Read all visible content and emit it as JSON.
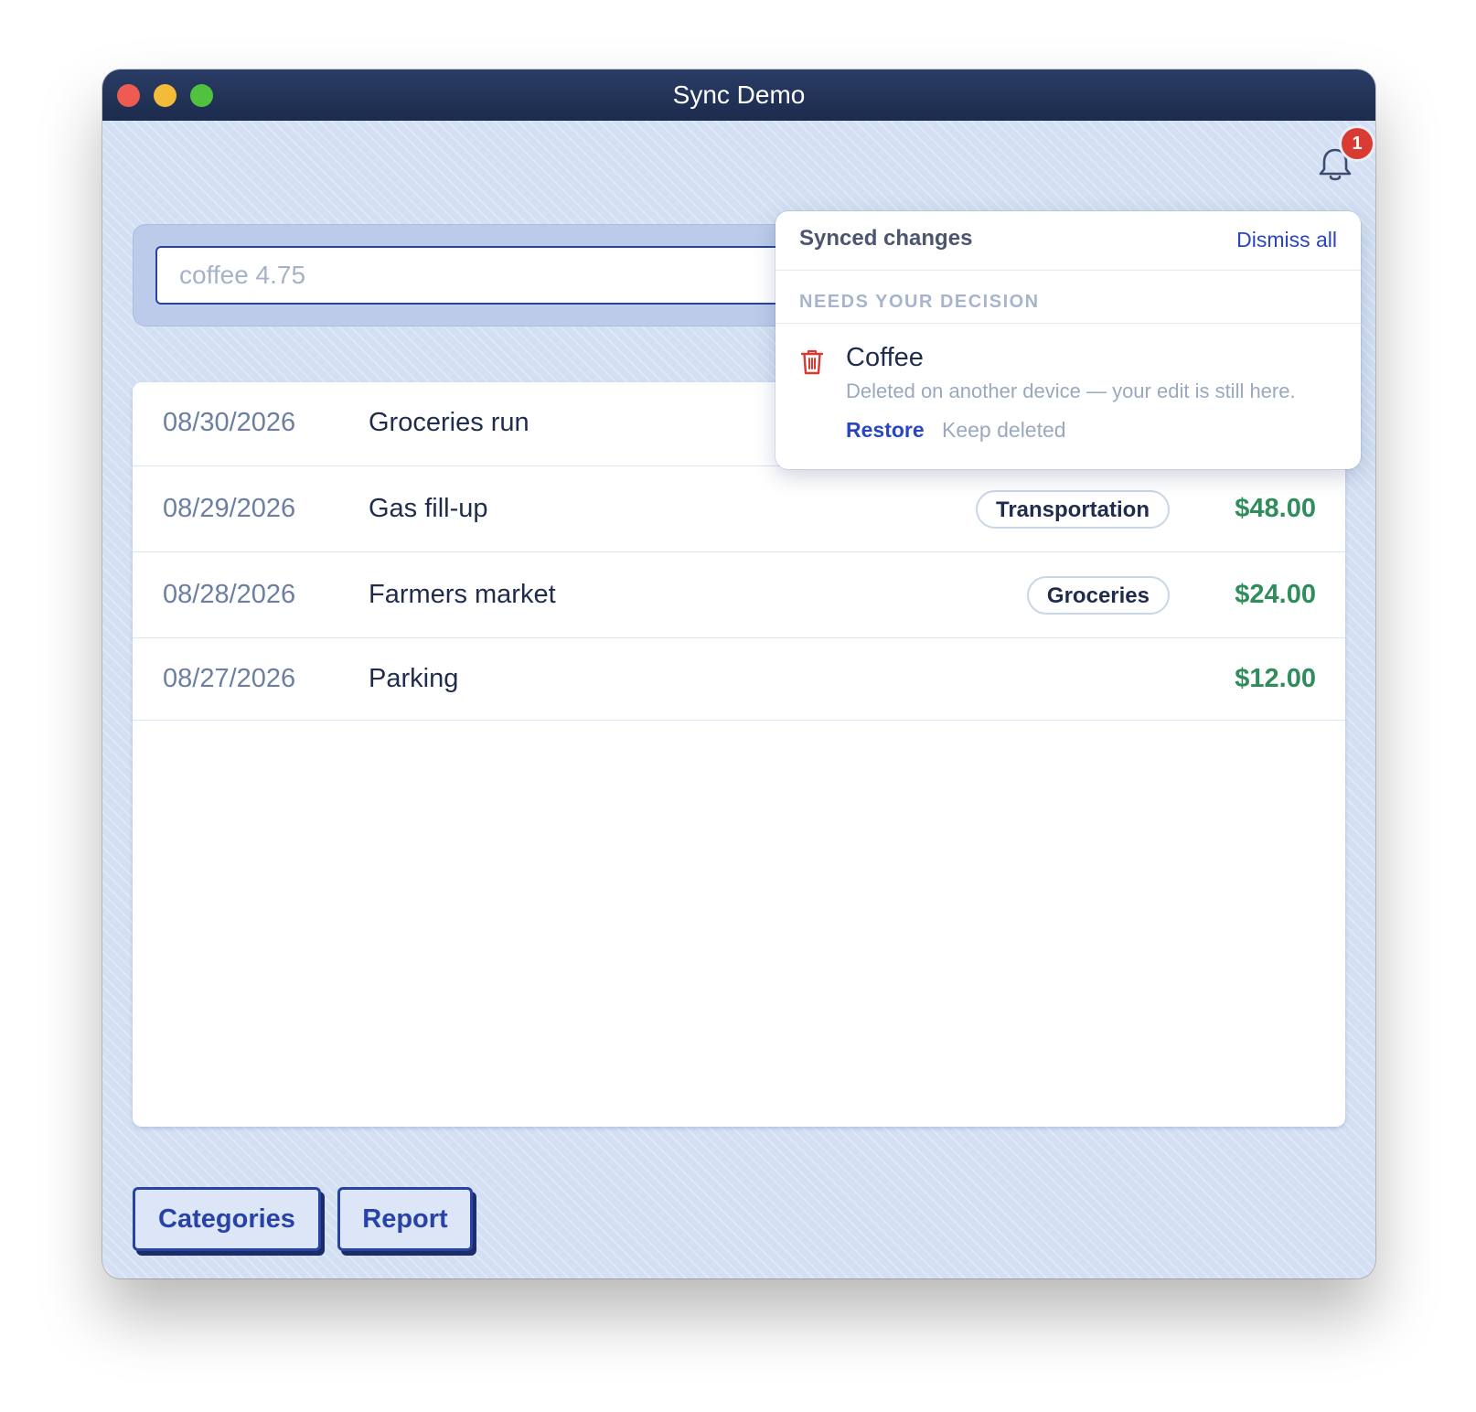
{
  "window": {
    "title": "Sync Demo"
  },
  "notifications": {
    "count": "1",
    "icon": "bell-icon"
  },
  "entry": {
    "placeholder": "coffee 4.75",
    "value": ""
  },
  "transactions": [
    {
      "date": "08/30/2026",
      "description": "Groceries run",
      "category": "",
      "amount": ""
    },
    {
      "date": "08/29/2026",
      "description": "Gas fill-up",
      "category": "Transportation",
      "amount": "$48.00"
    },
    {
      "date": "08/28/2026",
      "description": "Farmers market",
      "category": "Groceries",
      "amount": "$24.00"
    },
    {
      "date": "08/27/2026",
      "description": "Parking",
      "category": "",
      "amount": "$12.00"
    }
  ],
  "footer": {
    "categories_label": "Categories",
    "report_label": "Report"
  },
  "popover": {
    "title": "Synced changes",
    "dismiss_all_label": "Dismiss all",
    "section_label": "NEEDS YOUR DECISION",
    "item": {
      "icon": "trash-icon",
      "name": "Coffee",
      "description": "Deleted on another device — your edit is still here.",
      "restore_label": "Restore",
      "keep_deleted_label": "Keep deleted"
    }
  },
  "colors": {
    "accent": "#2643a5",
    "amount": "#2f8d5b",
    "badge": "#d93a31",
    "titlebar": "#1c2b4d"
  }
}
